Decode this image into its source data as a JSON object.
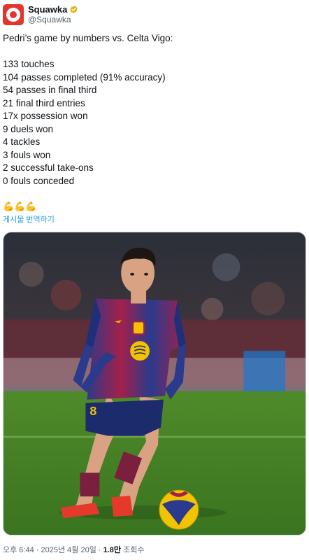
{
  "author": {
    "display_name": "Squawka",
    "handle": "@Squawka",
    "verified_color": "#e2b719",
    "avatar_color": "#e3342f"
  },
  "tweet": {
    "intro": "Pedri’s game by numbers vs. Celta Vigo:",
    "stats": [
      "133 touches",
      "104 passes completed (91% accuracy)",
      "54 passes in final third",
      "21 final third entries",
      "17x possession won",
      "9 duels won",
      "4 tackles",
      "3 fouls won",
      "2 successful take-ons",
      "0 fouls conceded"
    ],
    "emoji": "💪💪💪",
    "translate_label": "게시물 번역하기"
  },
  "media": {
    "icon": "photo-football-player",
    "shirt_number": "8"
  },
  "meta": {
    "time": "오후 6:44",
    "date": "2025년 4월 20일",
    "separator": "·",
    "views_count": "1.8만",
    "views_label": "조회수"
  }
}
